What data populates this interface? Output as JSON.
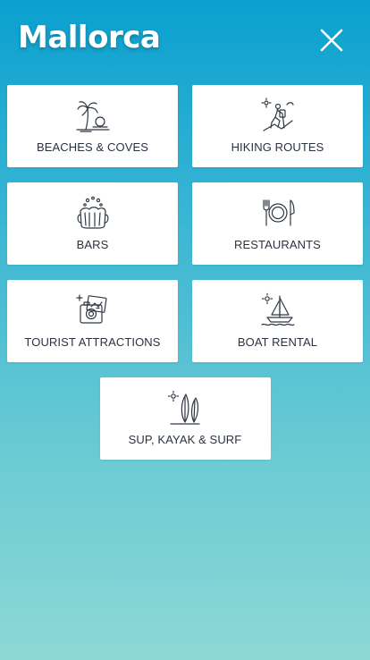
{
  "header": {
    "title": "Mallorca",
    "close_icon": "close-icon"
  },
  "categories": [
    {
      "label": "BEACHES & COVES",
      "icon": "beach-palm-icon"
    },
    {
      "label": "HIKING ROUTES",
      "icon": "hiker-icon"
    },
    {
      "label": "BARS",
      "icon": "beer-mug-icon"
    },
    {
      "label": "RESTAURANTS",
      "icon": "plate-cutlery-icon"
    },
    {
      "label": "TOURIST ATTRACTIONS",
      "icon": "camera-photo-icon"
    },
    {
      "label": "BOAT RENTAL",
      "icon": "sailboat-icon"
    },
    {
      "label": "SUP, KAYAK & SURF",
      "icon": "surfboard-icon"
    }
  ],
  "colors": {
    "gradient_top": "#0aa0cf",
    "gradient_bottom": "#8dd8d6",
    "card_bg": "#ffffff",
    "text": "#2b3340",
    "icon_stroke": "#2f3742"
  }
}
